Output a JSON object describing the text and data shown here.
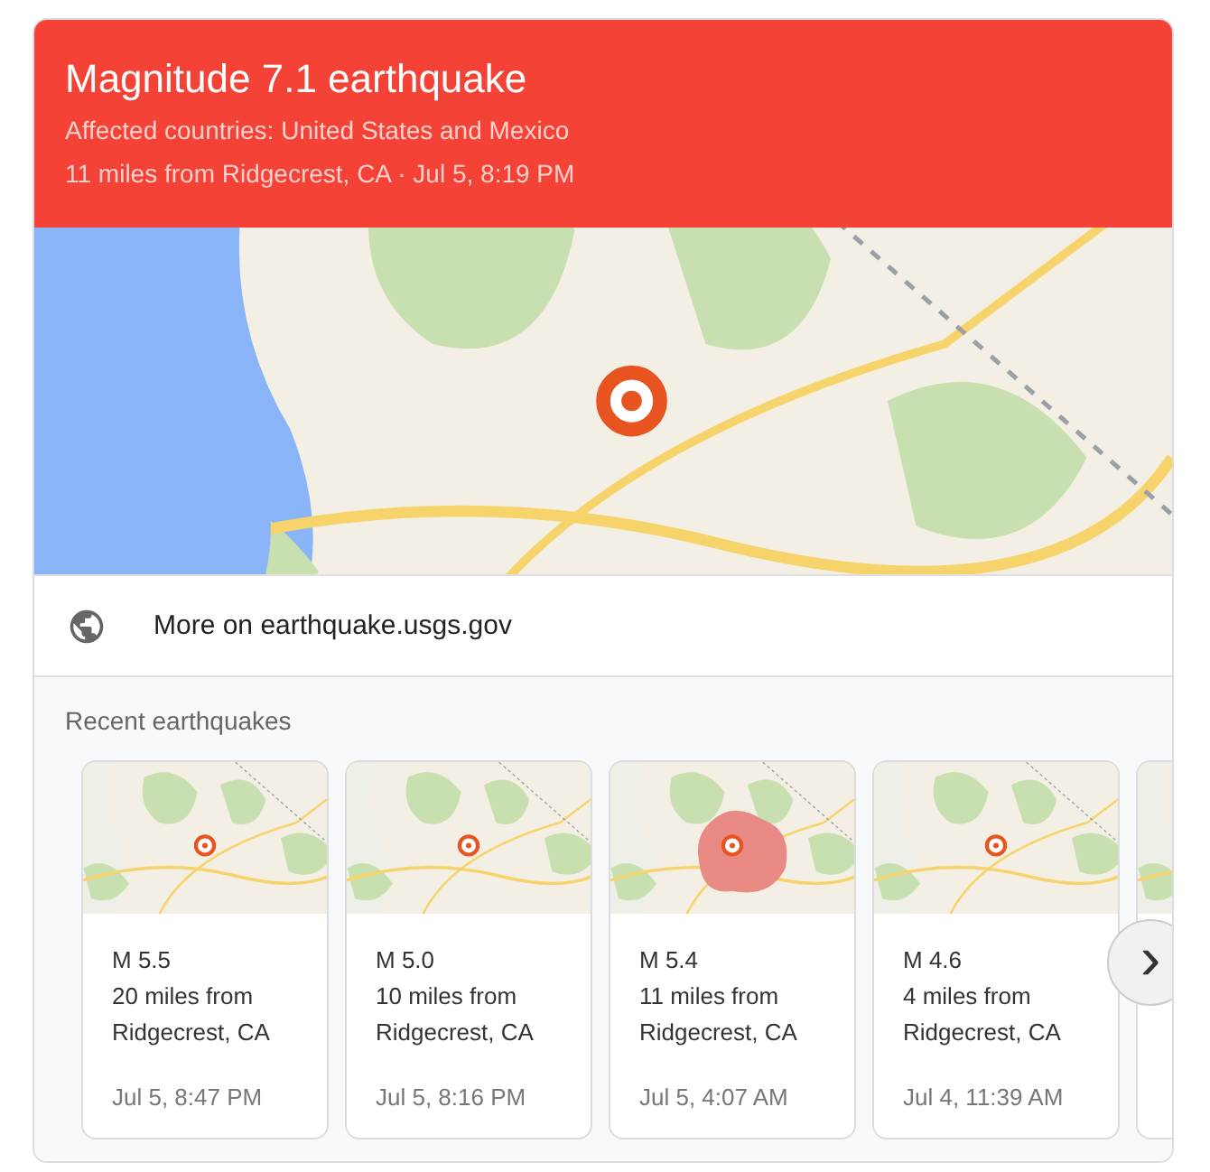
{
  "header": {
    "title": "Magnitude 7.1 earthquake",
    "affected": "Affected countries: United States and Mexico",
    "location": "11 miles from Ridgecrest, CA · Jul 5, 8:19 PM"
  },
  "source_link": {
    "label": "More on earthquake.usgs.gov"
  },
  "recent": {
    "title": "Recent earthquakes",
    "quakes": [
      {
        "magnitude": "M 5.5",
        "distance": "20 miles from",
        "place": "Ridgecrest, CA",
        "time": "Jul 5, 8:47 PM"
      },
      {
        "magnitude": "M 5.0",
        "distance": "10 miles from",
        "place": "Ridgecrest, CA",
        "time": "Jul 5, 8:16 PM"
      },
      {
        "magnitude": "M 5.4",
        "distance": "11 miles from",
        "place": "Ridgecrest, CA",
        "time": "Jul 5, 4:07 AM"
      },
      {
        "magnitude": "M 4.6",
        "distance": "4 miles from",
        "place": "Ridgecrest, CA",
        "time": "Jul 4, 11:39 AM"
      }
    ],
    "next_button": {
      "label": "›"
    }
  }
}
